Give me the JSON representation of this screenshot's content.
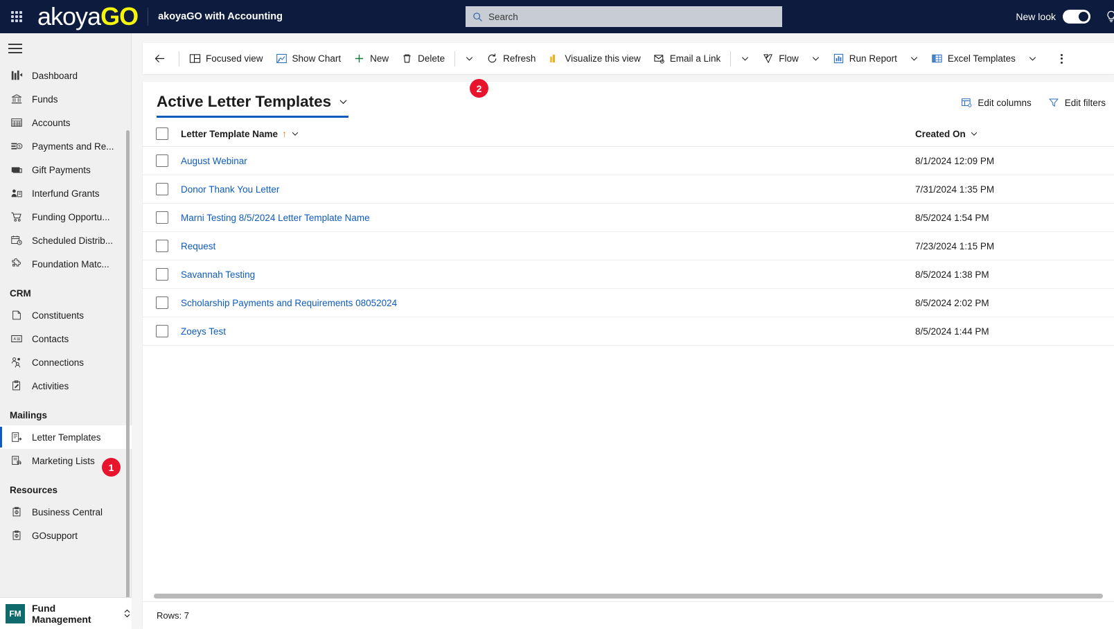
{
  "topbar": {
    "waffle_icon": "app-launcher-icon",
    "logo_primary": "akoya",
    "logo_accent": "GO",
    "app_name": "akoyaGO with Accounting",
    "search": {
      "placeholder": "Search",
      "value": "",
      "icon": "search-icon"
    },
    "new_look_label": "New look",
    "new_look_on": true,
    "help_icon": "lightbulb-icon"
  },
  "sidebar": {
    "hamburger_icon": "hamburger-menu-icon",
    "items": [
      {
        "label": "Dashboard",
        "icon": "dashboard-icon",
        "selected": false
      },
      {
        "label": "Funds",
        "icon": "bank-icon",
        "selected": false
      },
      {
        "label": "Accounts",
        "icon": "grid-table-icon",
        "selected": false
      },
      {
        "label": "Payments and Re...",
        "icon": "payment-list-icon",
        "selected": false
      },
      {
        "label": "Gift Payments",
        "icon": "money-icon",
        "selected": false
      },
      {
        "label": "Interfund Grants",
        "icon": "person-document-icon",
        "selected": false
      },
      {
        "label": "Funding Opportu...",
        "icon": "cart-icon",
        "selected": false
      },
      {
        "label": "Scheduled Distrib...",
        "icon": "calendar-clock-icon",
        "selected": false
      },
      {
        "label": "Foundation Matc...",
        "icon": "puzzle-icon",
        "selected": false
      }
    ],
    "group_crm": "CRM",
    "crm_items": [
      {
        "label": "Constituents",
        "icon": "constituent-icon",
        "selected": false
      },
      {
        "label": "Contacts",
        "icon": "contact-card-icon",
        "selected": false
      },
      {
        "label": "Connections",
        "icon": "connections-people-icon",
        "selected": false
      },
      {
        "label": "Activities",
        "icon": "activity-clipboard-icon",
        "selected": false
      }
    ],
    "group_mailings": "Mailings",
    "mailings_items": [
      {
        "label": "Letter Templates",
        "icon": "letter-template-icon",
        "selected": true,
        "badge": "1"
      },
      {
        "label": "Marketing Lists",
        "icon": "marketing-list-icon",
        "selected": false
      }
    ],
    "group_resources": "Resources",
    "resources_items": [
      {
        "label": "Business Central",
        "icon": "resource-link-icon",
        "selected": false
      },
      {
        "label": "GOsupport",
        "icon": "resource-link-icon",
        "selected": false
      }
    ],
    "area_switcher": {
      "badge": "FM",
      "label": "Fund Management",
      "chevron_icon": "chevron-updown-icon",
      "badge_color": "#0f6b6b"
    }
  },
  "commandbar": {
    "back_icon": "back-arrow-icon",
    "items": [
      {
        "label": "Focused view",
        "icon": "focused-view-icon",
        "type": "button"
      },
      {
        "label": "Show Chart",
        "icon": "show-chart-icon",
        "type": "button",
        "badge": "2"
      },
      {
        "label": "New",
        "icon": "new-plus-icon",
        "type": "button"
      },
      {
        "label": "Delete",
        "icon": "delete-trash-icon",
        "type": "button",
        "has_chevron": true
      },
      {
        "label": "Refresh",
        "icon": "refresh-icon",
        "type": "button"
      },
      {
        "label": "Visualize this view",
        "icon": "powerbi-visualize-icon",
        "type": "button"
      },
      {
        "label": "Email a Link",
        "icon": "email-link-icon",
        "type": "button",
        "has_chevron": true
      },
      {
        "label": "Flow",
        "icon": "flow-icon",
        "type": "button",
        "has_chevron": true
      },
      {
        "label": "Run Report",
        "icon": "run-report-icon",
        "type": "button",
        "has_chevron": true
      },
      {
        "label": "Excel Templates",
        "icon": "excel-templates-icon",
        "type": "button",
        "has_chevron": true
      }
    ],
    "overflow_icon": "more-vertical-icon"
  },
  "view": {
    "title": "Active Letter Templates",
    "title_chevron_icon": "chevron-down-icon",
    "edit_columns": {
      "label": "Edit columns",
      "icon": "edit-columns-icon"
    },
    "edit_filters": {
      "label": "Edit filters",
      "icon": "filter-icon"
    }
  },
  "table": {
    "select_all_checkbox": false,
    "columns": [
      {
        "label": "Letter Template Name",
        "sort": "asc",
        "sort_icon": "sort-asc-arrow",
        "chevron_icon": "chevron-down-icon"
      },
      {
        "label": "Created On",
        "sort": "none",
        "chevron_icon": "chevron-down-icon"
      }
    ],
    "rows": [
      {
        "name": "August Webinar",
        "created_on": "8/1/2024 12:09 PM",
        "checked": false
      },
      {
        "name": "Donor Thank You Letter",
        "created_on": "7/31/2024 1:35 PM",
        "checked": false
      },
      {
        "name": "Marni Testing 8/5/2024 Letter Template Name",
        "created_on": "8/5/2024 1:54 PM",
        "checked": false
      },
      {
        "name": "Request",
        "created_on": "7/23/2024 1:15 PM",
        "checked": false
      },
      {
        "name": "Savannah Testing",
        "created_on": "8/5/2024 1:38 PM",
        "checked": false
      },
      {
        "name": "Scholarship Payments and Requirements 08052024",
        "created_on": "8/5/2024 2:02 PM",
        "checked": false
      },
      {
        "name": "Zoeys Test",
        "created_on": "8/5/2024 1:44 PM",
        "checked": false
      }
    ]
  },
  "status": {
    "rows_label": "Rows: 7"
  },
  "colors": {
    "topbar_bg": "#0d1b3e",
    "accent_blue": "#0f5bbd",
    "badge_red": "#e8142d",
    "logo_yellow": "#f5f50a",
    "area_teal": "#0f6b6b",
    "sort_orange": "#d67b1c"
  }
}
